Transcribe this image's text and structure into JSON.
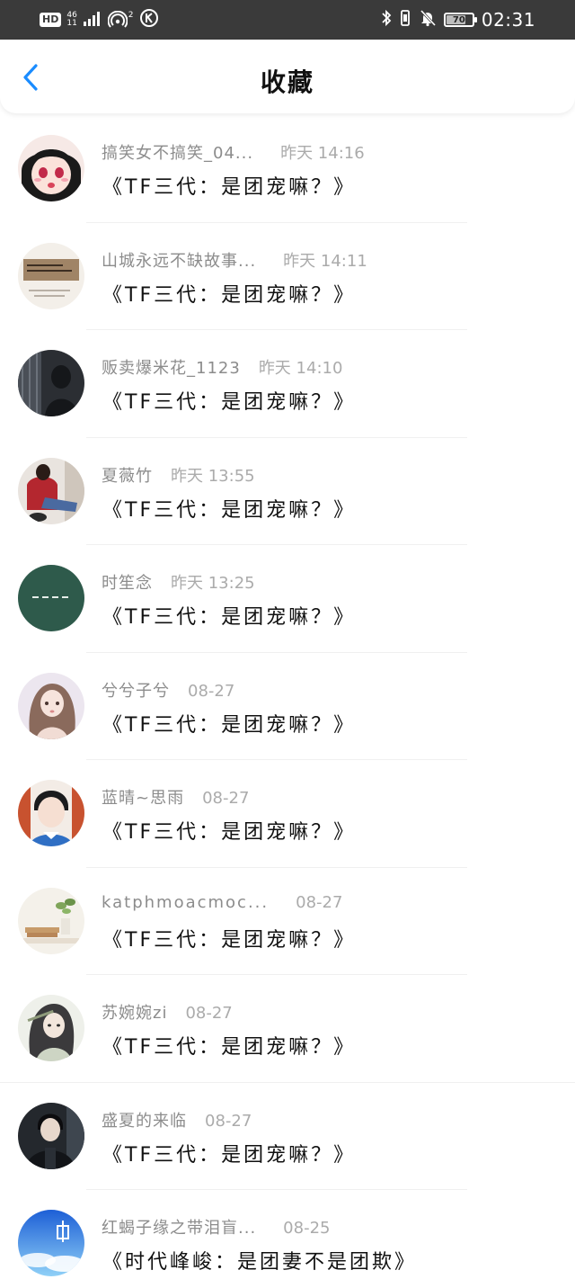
{
  "status_bar": {
    "hd": "HD",
    "network_top": "46",
    "network_bottom": "11",
    "hotspot_count": "2",
    "battery": "70",
    "time": "02:31"
  },
  "header": {
    "title": "收藏",
    "back_icon": "chevron-left-icon"
  },
  "colors": {
    "accent": "#1a8cff",
    "status_bar_bg": "#3a3a3a"
  },
  "items": [
    {
      "name": "搞笑女不搞笑_04...",
      "time": "昨天 14:16",
      "title": "《TF三代：是团宠嘛？》"
    },
    {
      "name": "山城永远不缺故事...",
      "time": "昨天 14:11",
      "title": "《TF三代：是团宠嘛？》"
    },
    {
      "name": "贩卖爆米花_1123",
      "time": "昨天 14:10",
      "title": "《TF三代：是团宠嘛？》"
    },
    {
      "name": "夏薇竹",
      "time": "昨天 13:55",
      "title": "《TF三代：是团宠嘛？》"
    },
    {
      "name": "时笙念",
      "time": "昨天 13:25",
      "title": "《TF三代：是团宠嘛？》"
    },
    {
      "name": "兮兮子兮",
      "time": "08-27",
      "title": "《TF三代：是团宠嘛？》"
    },
    {
      "name": "蓝晴~思雨",
      "time": "08-27",
      "title": "《TF三代：是团宠嘛？》"
    },
    {
      "name": "katphmoacmoc...",
      "time": "08-27",
      "title": "《TF三代：是团宠嘛？》"
    },
    {
      "name": "苏婉婉zi",
      "time": "08-27",
      "title": "《TF三代：是团宠嘛？》"
    },
    {
      "name": "盛夏的来临",
      "time": "08-27",
      "title": "《TF三代：是团宠嘛？》"
    },
    {
      "name": "红蝎子缘之带泪盲...",
      "time": "08-25",
      "title": "《时代峰峻：是团妻不是团欺》"
    }
  ]
}
